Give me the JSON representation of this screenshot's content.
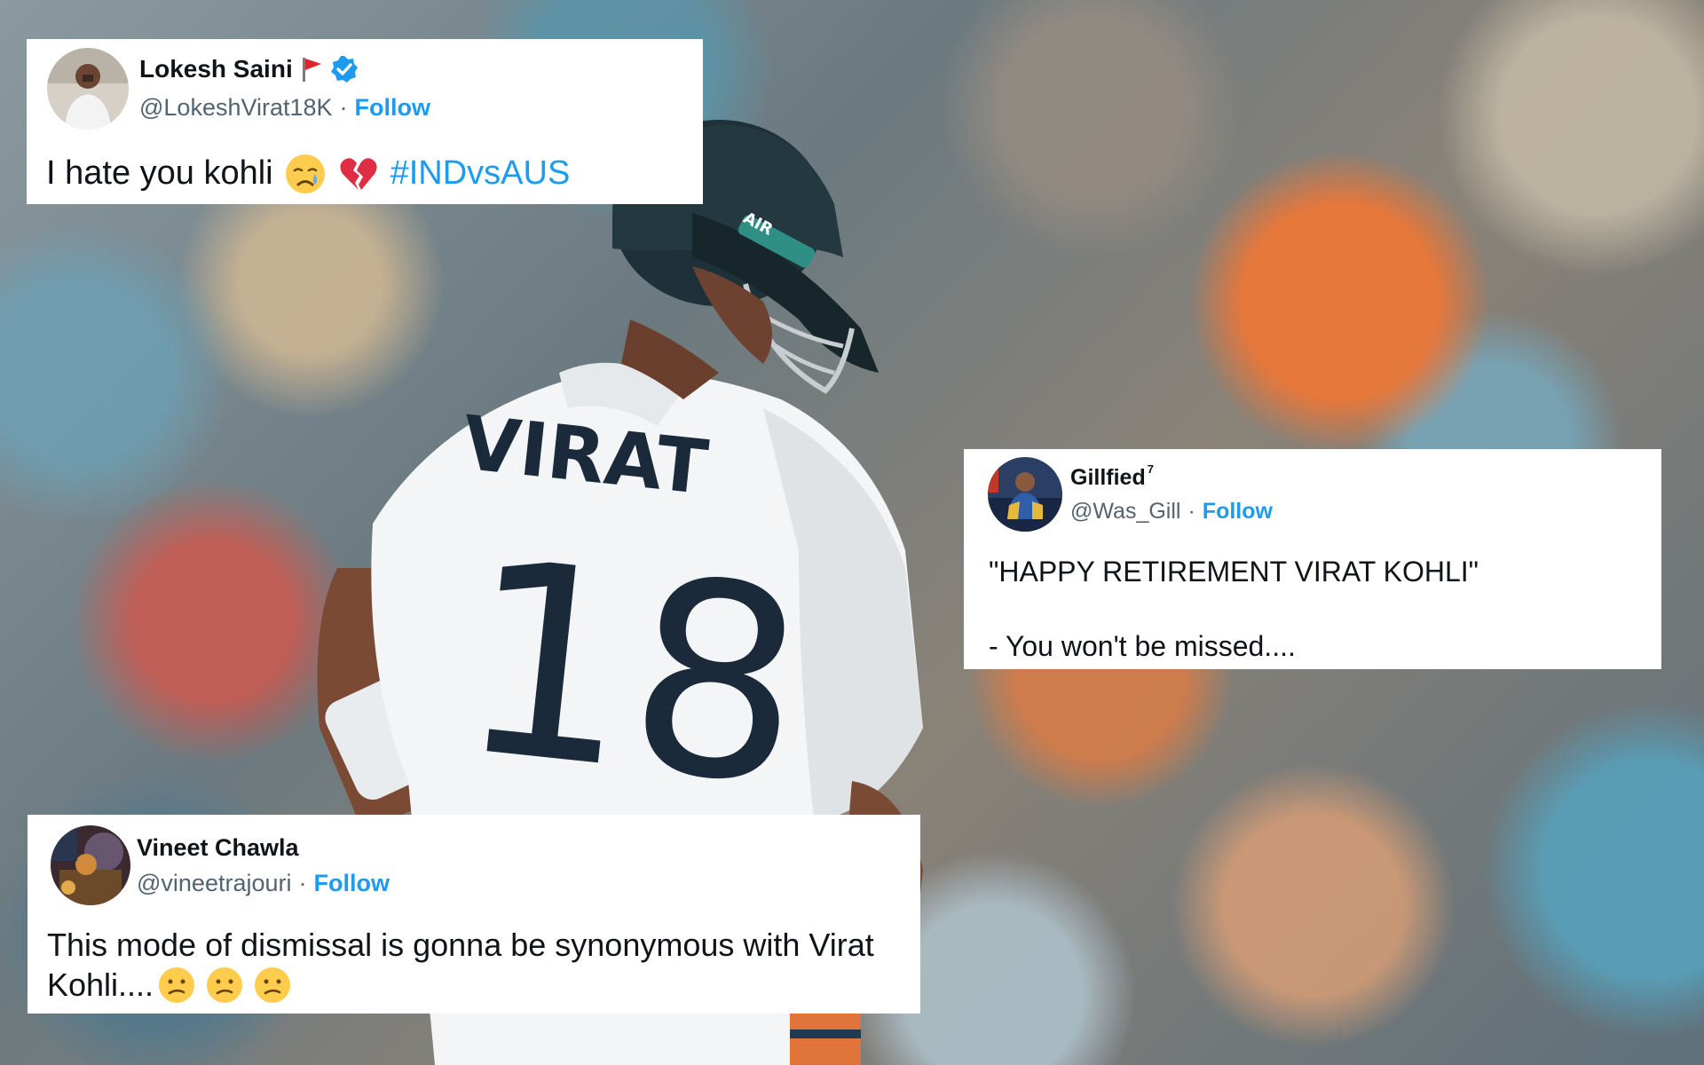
{
  "tweets": [
    {
      "name": "Lokesh Saini",
      "handle": "@LokeshVirat18K",
      "separator": "·",
      "follow_label": "Follow",
      "text": "I hate you kohli",
      "emojis": [
        "crying-face",
        "broken-heart"
      ],
      "hashtag": "#INDvsAUS",
      "verified": true,
      "name_flag_icon": "red-flag-icon"
    },
    {
      "name": "Gillfied",
      "name_superscript": "7",
      "handle": "@Was_Gill",
      "separator": "·",
      "follow_label": "Follow",
      "text_line_1": "\"HAPPY RETIREMENT VIRAT KOHLI\"",
      "text_line_2": "- You won't be missed...."
    },
    {
      "name": "Vineet Chawla",
      "handle": "@vineetrajouri",
      "separator": "·",
      "follow_label": "Follow",
      "text_line_1": "This mode of dismissal is gonna be synonymous with Virat",
      "text_line_2": "Kohli....",
      "emojis": [
        "confused-face",
        "confused-face",
        "confused-face"
      ]
    }
  ],
  "background": {
    "jersey_name": "VIRAT",
    "jersey_number": "18",
    "helmet_label": "AIR"
  },
  "colors": {
    "link_blue": "#1d9bf0",
    "text_dark": "#0f1419",
    "text_grey": "#536471",
    "card_bg": "#ffffff"
  }
}
